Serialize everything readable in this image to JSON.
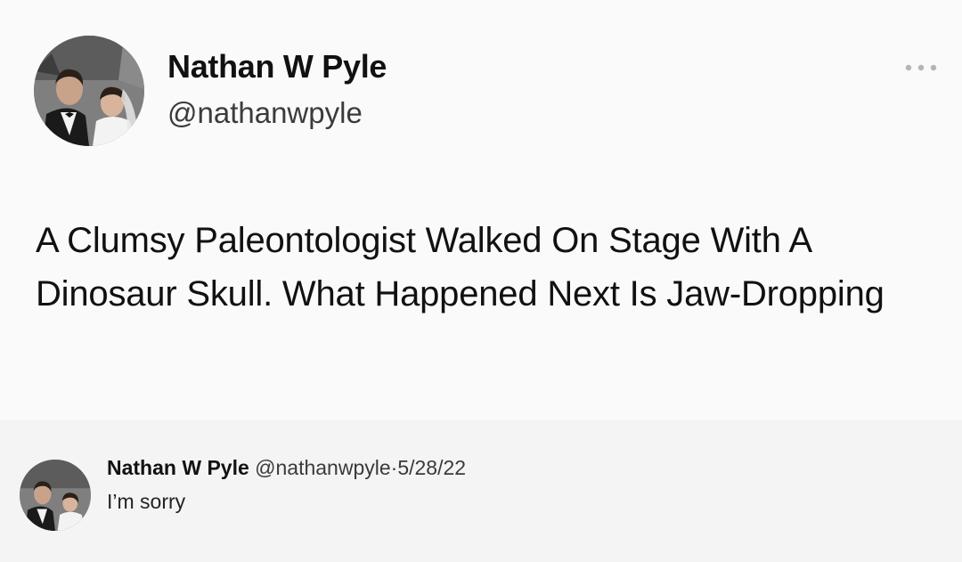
{
  "tweet": {
    "display_name": "Nathan W Pyle",
    "handle": "@nathanwpyle",
    "more_icon": "more-horizontal-icon",
    "text": "A Clumsy Paleontologist Walked On Stage With A Dinosaur Skull. What Happened Next Is Jaw-Dropping"
  },
  "reply": {
    "display_name": "Nathan W Pyle",
    "handle": "@nathanwpyle",
    "separator": "·",
    "date": "5/28/22",
    "text": "I’m sorry"
  },
  "colors": {
    "background": "#f4f4f4",
    "card": "#fafafa",
    "text": "#111111",
    "muted": "#3b3b3b"
  }
}
